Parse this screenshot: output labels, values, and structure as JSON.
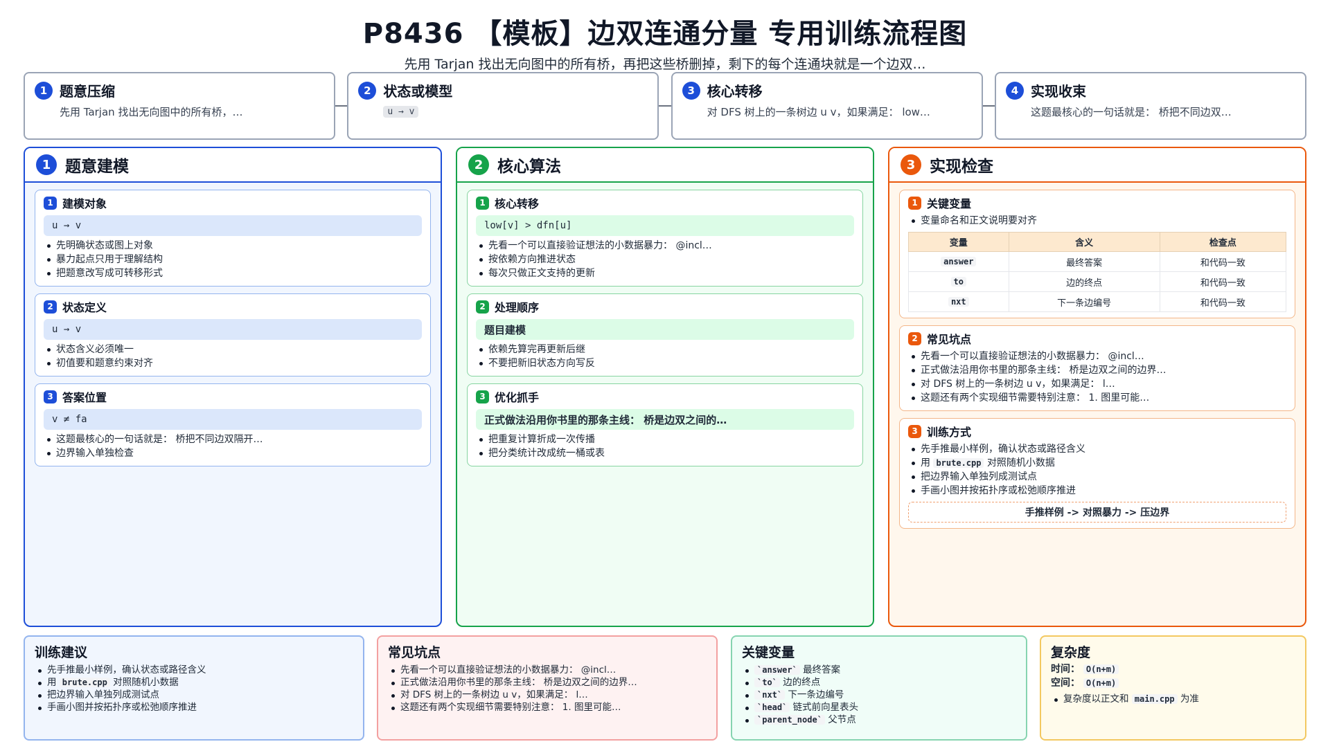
{
  "title": "P8436 【模板】边双连通分量 专用训练流程图",
  "subtitle": "先用 Tarjan 找出无向图中的所有桥，再把这些桥删掉，剩下的每个连通块就是一个边双…",
  "steps": [
    {
      "num": "1",
      "title": "题意压缩",
      "desc": "先用 Tarjan 找出无向图中的所有桥，…",
      "code": ""
    },
    {
      "num": "2",
      "title": "状态或模型",
      "desc": "",
      "code": "u → v"
    },
    {
      "num": "3",
      "title": "核心转移",
      "desc": "对 DFS 树上的一条树边 u v，如果满足：  low…",
      "code": ""
    },
    {
      "num": "4",
      "title": "实现收束",
      "desc": "这题最核心的一句话就是：  桥把不同边双…",
      "code": ""
    }
  ],
  "columns": {
    "c1": {
      "num": "1",
      "title": "题意建模",
      "cards": [
        {
          "num": "1",
          "title": "建模对象",
          "hl": "u → v",
          "items": [
            "先明确状态或图上对象",
            "暴力起点只用于理解结构",
            "把题意改写成可转移形式"
          ]
        },
        {
          "num": "2",
          "title": "状态定义",
          "hl": "u → v",
          "items": [
            "状态含义必须唯一",
            "初值要和题意约束对齐"
          ]
        },
        {
          "num": "3",
          "title": "答案位置",
          "hl": "v ≠ fa",
          "items": [
            "这题最核心的一句话就是：  桥把不同边双隔开…",
            "边界输入单独检查"
          ]
        }
      ]
    },
    "c2": {
      "num": "2",
      "title": "核心算法",
      "cards": [
        {
          "num": "1",
          "title": "核心转移",
          "hl": "low[v] > dfn[u]",
          "items": [
            "先看一个可以直接验证想法的小数据暴力：  @incl…",
            "按依赖方向推进状态",
            "每次只做正文支持的更新"
          ]
        },
        {
          "num": "2",
          "title": "处理顺序",
          "hl": "题目建模",
          "items": [
            "依赖先算完再更新后继",
            "不要把新旧状态方向写反"
          ]
        },
        {
          "num": "3",
          "title": "优化抓手",
          "hl": "正式做法沿用你书里的那条主线：  桥是边双之间的…",
          "items": [
            "把重复计算折成一次传播",
            "把分类统计改成统一桶或表"
          ]
        }
      ]
    },
    "c3": {
      "num": "3",
      "title": "实现检查",
      "card1": {
        "num": "1",
        "title": "关键变量",
        "items": [
          "变量命名和正文说明要对齐"
        ],
        "headers": [
          "变量",
          "含义",
          "检查点"
        ],
        "rows": [
          [
            "answer",
            "最终答案",
            "和代码一致"
          ],
          [
            "to",
            "边的终点",
            "和代码一致"
          ],
          [
            "nxt",
            "下一条边编号",
            "和代码一致"
          ]
        ]
      },
      "card2": {
        "num": "2",
        "title": "常见坑点",
        "items": [
          "先看一个可以直接验证想法的小数据暴力：  @incl…",
          "正式做法沿用你书里的那条主线：  桥是边双之间的边界…",
          "对 DFS 树上的一条树边 u v，如果满足：  l…",
          "这题还有两个实现细节需要特别注意：  1. 图里可能…"
        ]
      },
      "card3": {
        "num": "3",
        "title": "训练方式",
        "items": [
          "先手推最小样例，确认状态或路径含义",
          "对照随机小数据",
          "把边界输入单独列成测试点",
          "手画小图并按拓扑序或松弛顺序推进"
        ],
        "brute_prefix": "用",
        "brute_code": "brute.cpp",
        "footer": "手推样例 -> 对照暴力 -> 压边界"
      }
    }
  },
  "bottom": {
    "train": {
      "title": "训练建议",
      "items": [
        "先手推最小样例，确认状态或路径含义",
        "对照随机小数据",
        "把边界输入单独列成测试点",
        "手画小图并按拓扑序或松弛顺序推进"
      ],
      "brute_prefix": "用",
      "brute_code": "brute.cpp"
    },
    "pitfalls": {
      "title": "常见坑点",
      "items": [
        "先看一个可以直接验证想法的小数据暴力：  @incl…",
        "正式做法沿用你书里的那条主线：  桥是边双之间的边界…",
        "对 DFS 树上的一条树边 u v，如果满足：  l…",
        "这题还有两个实现细节需要特别注意：  1. 图里可能…"
      ]
    },
    "vars": {
      "title": "关键变量",
      "items": [
        {
          "code": "`answer`",
          "desc": "最终答案"
        },
        {
          "code": "`to`",
          "desc": "边的终点"
        },
        {
          "code": "`nxt`",
          "desc": "下一条边编号"
        },
        {
          "code": "`head`",
          "desc": "链式前向星表头"
        },
        {
          "code": "`parent_node`",
          "desc": "父节点"
        }
      ]
    },
    "complexity": {
      "title": "复杂度",
      "time_label": "时间：",
      "time_value": "O(n+m)",
      "space_label": "空间：",
      "space_value": "O(n+m)",
      "note_prefix": "复杂度以正文和",
      "note_code": "main.cpp",
      "note_suffix": "为准"
    }
  }
}
